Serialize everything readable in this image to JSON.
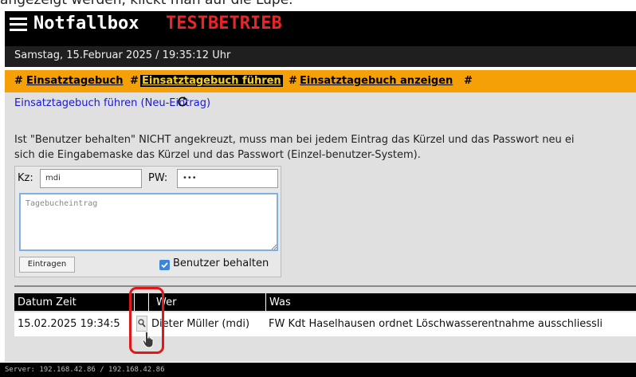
{
  "top_caption": "angezeigt werden, klickt man auf die Lupe.",
  "header": {
    "title": "Notfallbox",
    "mode": "TESTBETRIEB"
  },
  "datetime": "Samstag, 15.Februar 2025 / 19:35:12 Uhr",
  "nav": {
    "sep": "#",
    "items": [
      {
        "label": "Einsatztagebuch",
        "active": false
      },
      {
        "label": "Einsatztagebuch führen",
        "active": true
      },
      {
        "label": "Einsatztagebuch anzeigen",
        "active": false
      }
    ]
  },
  "page_heading": "Einsatztagebuch führen (Neu-Eintrag)",
  "info_text": {
    "line1": "Ist \"Benutzer behalten\" NICHT angekreuzt, muss man bei jedem Eintrag das Kürzel und das Passwort neu ei",
    "line2": "sich die Eingabemaske das Kürzel und das Passwort (Einzel-benutzer-System)."
  },
  "form": {
    "kz_label": "Kz:",
    "kz_value": "mdi",
    "pw_label": "PW:",
    "pw_value": "•••",
    "diary_placeholder": "Tagebucheintrag",
    "submit_label": "Eintragen",
    "keep_user_label": "Benutzer behalten",
    "keep_user_checked": true
  },
  "table": {
    "headers": [
      "Datum Zeit",
      "",
      "Wer",
      "Was"
    ],
    "rows": [
      {
        "datetime": "15.02.2025 19:34:5",
        "who": "Dieter Müller (mdi)",
        "what": "FW Kdt Haselhausen ordnet Löschwasserentnahme ausschliessli"
      }
    ]
  },
  "footer": {
    "server": "Server: 192.168.42.86 / 192.168.42.86"
  },
  "colors": {
    "header_bg": "#000000",
    "mode": "#e8262a",
    "nav_bg": "#f5a007",
    "nav_active_text": "#f5d020",
    "heading": "#1a1ad0",
    "highlight": "#e01818"
  }
}
